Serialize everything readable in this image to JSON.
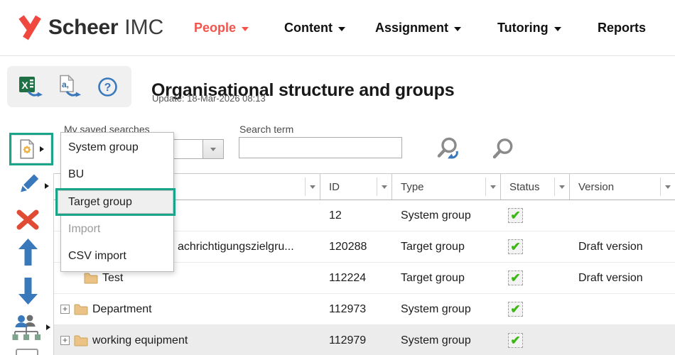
{
  "brand": {
    "scheer": "Scheer",
    "imc": "IMC"
  },
  "nav": {
    "items": [
      {
        "label": "People",
        "active": true,
        "dropdown": true
      },
      {
        "label": "Content",
        "active": false,
        "dropdown": true
      },
      {
        "label": "Assignment",
        "active": false,
        "dropdown": true
      },
      {
        "label": "Tutoring",
        "active": false,
        "dropdown": true
      },
      {
        "label": "Reports",
        "active": false,
        "dropdown": false
      }
    ]
  },
  "page": {
    "title": "Organisational structure and groups",
    "update_text": "Update: 18-Mar-2026 08:13"
  },
  "toolbar": {
    "icons": [
      "excel-export-icon",
      "text-export-icon",
      "help-icon"
    ]
  },
  "sidebar": {
    "tools": [
      "new-item",
      "edit",
      "delete",
      "move-up",
      "move-down",
      "org-chart",
      "clipped-tool"
    ],
    "highlighted_tool": "new-item"
  },
  "filters": {
    "saved_searches_label": "My saved searches",
    "saved_searches_value": "",
    "search_term_label": "Search term",
    "search_term_value": "",
    "actions": [
      "search-refresh-icon",
      "search-icon"
    ]
  },
  "context_menu": {
    "items": [
      {
        "label": "System group",
        "disabled": false,
        "highlighted": false
      },
      {
        "label": "BU",
        "disabled": false,
        "highlighted": false
      },
      {
        "label": "Target group",
        "disabled": false,
        "highlighted": true
      },
      {
        "label": "Import",
        "disabled": true,
        "highlighted": false
      },
      {
        "label": "CSV import",
        "disabled": false,
        "highlighted": false
      }
    ]
  },
  "table": {
    "columns": [
      "",
      "ID",
      "Type",
      "Status",
      "Version"
    ],
    "rows": [
      {
        "name": "",
        "id": "12",
        "type": "System group",
        "status": true,
        "version": "",
        "expand": false,
        "folder": false,
        "shaded": false
      },
      {
        "name": "achrichtigungszielgru...",
        "id": "120288",
        "type": "Target group",
        "status": true,
        "version": "Draft version",
        "expand": false,
        "folder": false,
        "shaded": false
      },
      {
        "name": "Test",
        "id": "112224",
        "type": "Target group",
        "status": true,
        "version": "Draft version",
        "expand": false,
        "folder": true,
        "shaded": false
      },
      {
        "name": "Department",
        "id": "112973",
        "type": "System group",
        "status": true,
        "version": "",
        "expand": true,
        "folder": true,
        "shaded": false
      },
      {
        "name": "working equipment",
        "id": "112979",
        "type": "System group",
        "status": true,
        "version": "",
        "expand": true,
        "folder": true,
        "shaded": true
      }
    ]
  },
  "colors": {
    "accent_red": "#f2544c",
    "annotation_green": "#1aa489",
    "icon_blue": "#3a78bc",
    "check_green": "#3fb618",
    "folder_tan": "#ecc386",
    "excel_green": "#1f7145"
  }
}
